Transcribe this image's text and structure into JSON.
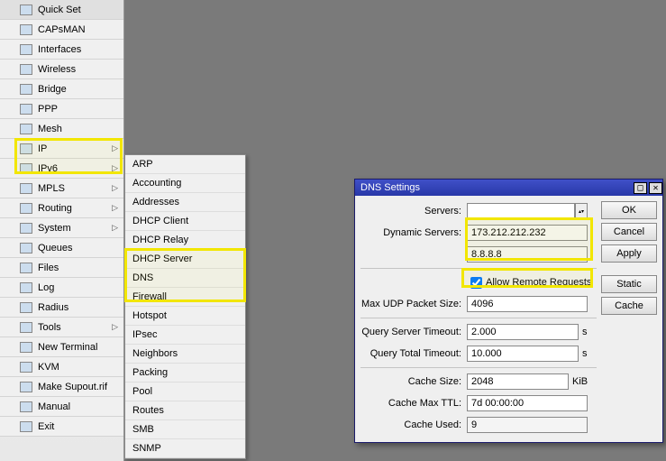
{
  "sidebar": {
    "items": [
      {
        "label": "Quick Set",
        "chev": false
      },
      {
        "label": "CAPsMAN",
        "chev": false
      },
      {
        "label": "Interfaces",
        "chev": false
      },
      {
        "label": "Wireless",
        "chev": false
      },
      {
        "label": "Bridge",
        "chev": false
      },
      {
        "label": "PPP",
        "chev": false
      },
      {
        "label": "Mesh",
        "chev": false
      },
      {
        "label": "IP",
        "chev": true
      },
      {
        "label": "IPv6",
        "chev": true
      },
      {
        "label": "MPLS",
        "chev": true
      },
      {
        "label": "Routing",
        "chev": true
      },
      {
        "label": "System",
        "chev": true
      },
      {
        "label": "Queues",
        "chev": false
      },
      {
        "label": "Files",
        "chev": false
      },
      {
        "label": "Log",
        "chev": false
      },
      {
        "label": "Radius",
        "chev": false
      },
      {
        "label": "Tools",
        "chev": true
      },
      {
        "label": "New Terminal",
        "chev": false
      },
      {
        "label": "KVM",
        "chev": false
      },
      {
        "label": "Make Supout.rif",
        "chev": false
      },
      {
        "label": "Manual",
        "chev": false
      },
      {
        "label": "Exit",
        "chev": false
      }
    ]
  },
  "submenu": {
    "items": [
      "ARP",
      "Accounting",
      "Addresses",
      "DHCP Client",
      "DHCP Relay",
      "DHCP Server",
      "DNS",
      "Firewall",
      "Hotspot",
      "IPsec",
      "Neighbors",
      "Packing",
      "Pool",
      "Routes",
      "SMB",
      "SNMP"
    ]
  },
  "dns": {
    "title": "DNS Settings",
    "labels": {
      "servers": "Servers:",
      "dyn": "Dynamic Servers:",
      "allow": "Allow Remote Requests",
      "maxudp": "Max UDP Packet Size:",
      "qst": "Query Server Timeout:",
      "qtt": "Query Total Timeout:",
      "csize": "Cache Size:",
      "cttl": "Cache Max TTL:",
      "cused": "Cache Used:",
      "s": "s",
      "kib": "KiB"
    },
    "values": {
      "servers": "",
      "dyn1": "173.212.212.232",
      "dyn2": "8.8.8.8",
      "allow_checked": true,
      "maxudp": "4096",
      "qst": "2.000",
      "qtt": "10.000",
      "csize": "2048",
      "cttl": "7d 00:00:00",
      "cused": "9"
    },
    "buttons": {
      "ok": "OK",
      "cancel": "Cancel",
      "apply": "Apply",
      "static": "Static",
      "cache": "Cache"
    }
  }
}
